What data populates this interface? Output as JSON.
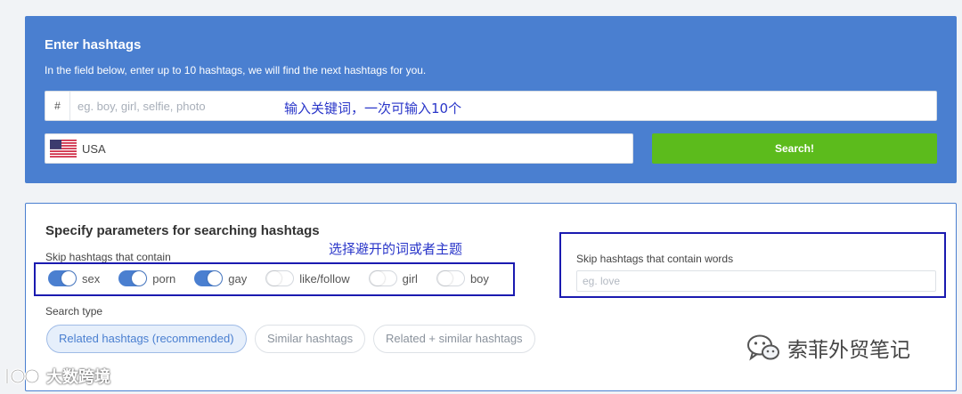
{
  "enter": {
    "title": "Enter hashtags",
    "subtitle": "In the field below, enter up to 10 hashtags, we will find the next hashtags for you.",
    "hash_prefix": "#",
    "hashtag_placeholder": "eg. boy, girl, selfie, photo",
    "annotation": "输入关键词，一次可输入10个",
    "country": "USA",
    "search_label": "Search!"
  },
  "params": {
    "title": "Specify parameters for searching hashtags",
    "annotation": "选择避开的词或者主题",
    "skip_label": "Skip hashtags that contain",
    "toggles": [
      {
        "label": "sex",
        "on": true
      },
      {
        "label": "porn",
        "on": true
      },
      {
        "label": "gay",
        "on": true
      },
      {
        "label": "like/follow",
        "on": false
      },
      {
        "label": "girl",
        "on": false
      },
      {
        "label": "boy",
        "on": false
      }
    ],
    "words_label": "Skip hashtags that contain words",
    "words_placeholder": "eg. love",
    "search_type_label": "Search type",
    "search_types": [
      {
        "label": "Related hashtags (recommended)",
        "active": true
      },
      {
        "label": "Similar hashtags",
        "active": false
      },
      {
        "label": "Related + similar hashtags",
        "active": false
      }
    ]
  },
  "watermarks": {
    "right": "索菲外贸笔记",
    "left": "大数跨境"
  },
  "colors": {
    "panel_blue": "#4a7fd0",
    "search_green": "#5cbb1c",
    "annotation_blue": "#2a36c9"
  }
}
